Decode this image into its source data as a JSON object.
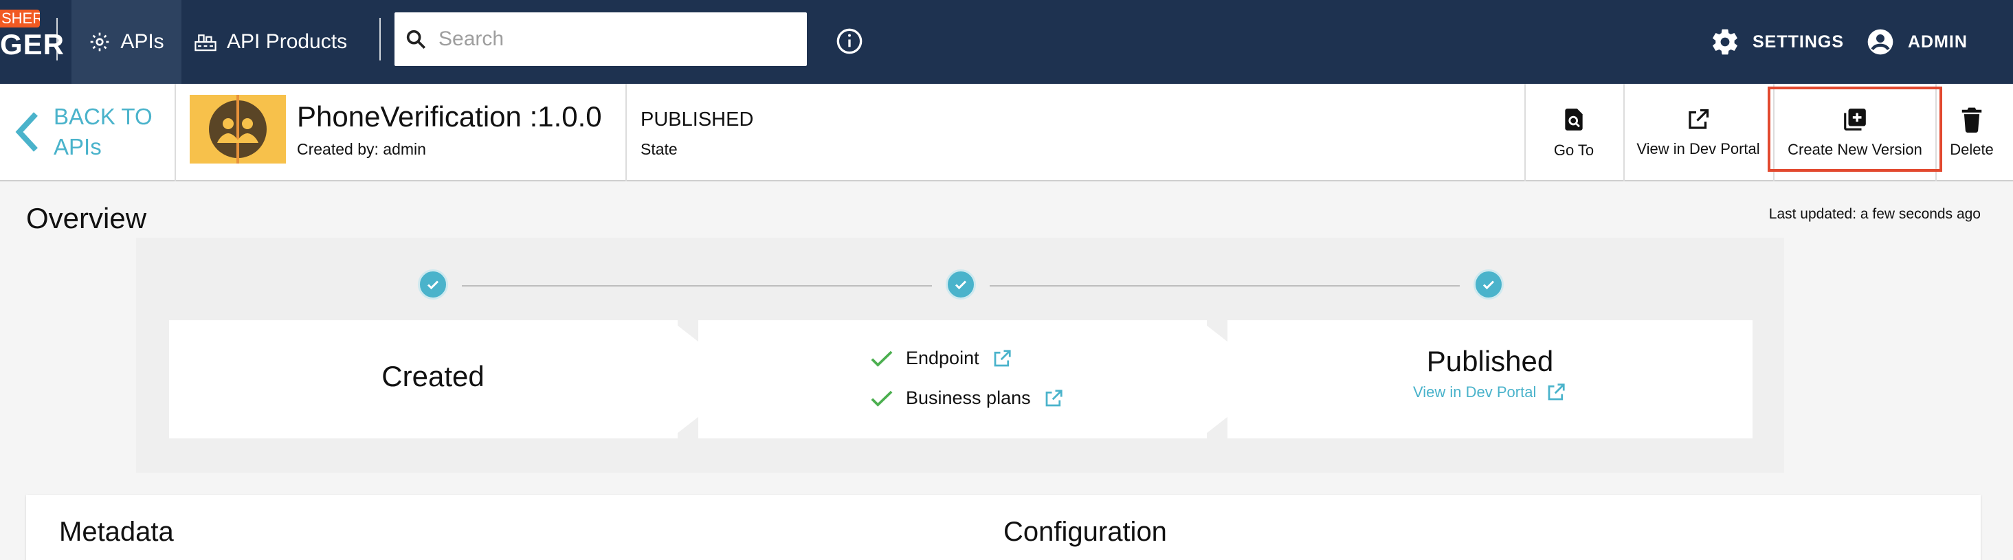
{
  "brand": {
    "badge": "SHER",
    "text": "GER"
  },
  "nav": {
    "apis": "APIs",
    "api_products": "API Products"
  },
  "search": {
    "placeholder": "Search"
  },
  "topbar_right": {
    "settings": "SETTINGS",
    "admin": "ADMIN"
  },
  "header": {
    "back_line1": "BACK TO",
    "back_line2": "APIs",
    "api_name": "PhoneVerification :1.0.0",
    "created_by": "Created by: admin",
    "state_value": "PUBLISHED",
    "state_label": "State",
    "buttons": {
      "goto": "Go To",
      "view_dev_portal": "View in Dev Portal",
      "create_new_version": "Create New Version",
      "delete": "Delete"
    }
  },
  "overview": {
    "title": "Overview",
    "last_updated": "Last updated: a few seconds ago",
    "stages": {
      "created": "Created",
      "endpoint": "Endpoint",
      "business_plans": "Business plans",
      "published": "Published",
      "published_link": "View in Dev Portal"
    }
  },
  "sections": {
    "metadata": "Metadata",
    "configuration": "Configuration"
  },
  "colors": {
    "topbar": "#1e3250",
    "accent": "#4ab3cb",
    "highlight": "#e2492f",
    "brand_badge": "#f15a22",
    "check": "#4caf50"
  }
}
